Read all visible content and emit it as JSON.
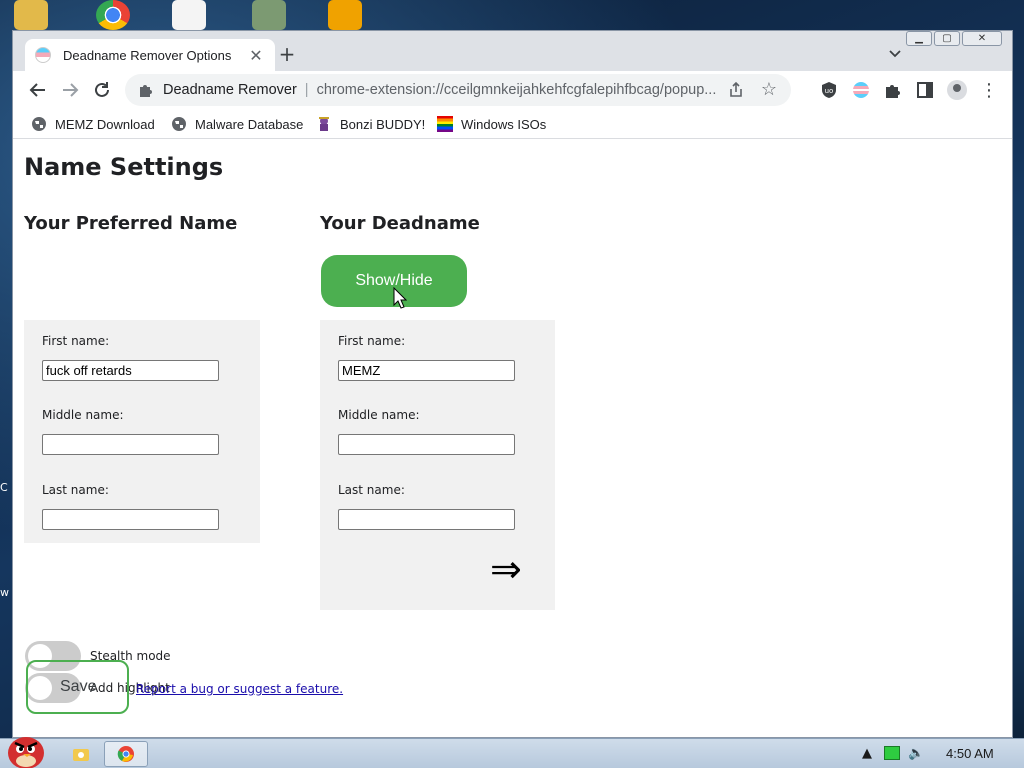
{
  "browser": {
    "tab_title": "Deadname Remover Options",
    "new_tab_symbol": "+",
    "site_name": "Deadname Remover",
    "url": "chrome-extension://cceilgmnkeijahkehfcgfalepihfbcag/popup...",
    "bookmarks": [
      {
        "label": "MEMZ Download",
        "icon": "globe-icon"
      },
      {
        "label": "Malware Database",
        "icon": "globe-icon"
      },
      {
        "label": "Bonzi BUDDY!",
        "icon": "bonzi-icon"
      },
      {
        "label": "Windows ISOs",
        "icon": "rainbow-flag-icon"
      }
    ]
  },
  "page": {
    "title": "Name Settings",
    "preferred": {
      "heading": "Your Preferred Name",
      "first_label": "First name:",
      "first_value": "fuck off retards",
      "middle_label": "Middle name:",
      "middle_value": "",
      "last_label": "Last name:",
      "last_value": ""
    },
    "deadname": {
      "heading": "Your Deadname",
      "toggle_button": "Show/Hide",
      "first_label": "First name:",
      "first_value": "MEMZ",
      "middle_label": "Middle name:",
      "middle_value": "",
      "last_label": "Last name:",
      "last_value": "",
      "arrow_symbol": "⇒"
    },
    "options": {
      "stealth_label": "Stealth mode",
      "highlight_label": "Add highlight",
      "save_label": "Save",
      "bug_link": "Report a bug or suggest a feature."
    }
  },
  "taskbar": {
    "clock": "4:50 AM"
  },
  "colors": {
    "accent_green": "#4caf50",
    "panel_bg": "#f1f1f1"
  }
}
